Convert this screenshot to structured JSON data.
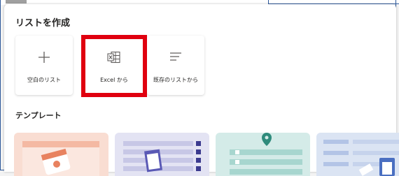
{
  "panel": {
    "title": "リストを作成",
    "create_options": [
      {
        "label": "空白のリスト",
        "icon": "plus-icon"
      },
      {
        "label": "Excel から",
        "icon": "excel-icon"
      },
      {
        "label": "既存のリストから",
        "icon": "list-lines-icon"
      }
    ],
    "templates_heading": "テンプレート",
    "templates": [
      {
        "icon": "event-calendar-icon",
        "color": "#f9ddd2"
      },
      {
        "icon": "issue-tracker-clipboard-icon",
        "color": "#e3e3f3"
      },
      {
        "icon": "map-pin-icon",
        "color": "#d4ebe8"
      },
      {
        "icon": "task-board-icon",
        "color": "#dbe4f3"
      }
    ]
  },
  "highlight_color": "#e0000f"
}
